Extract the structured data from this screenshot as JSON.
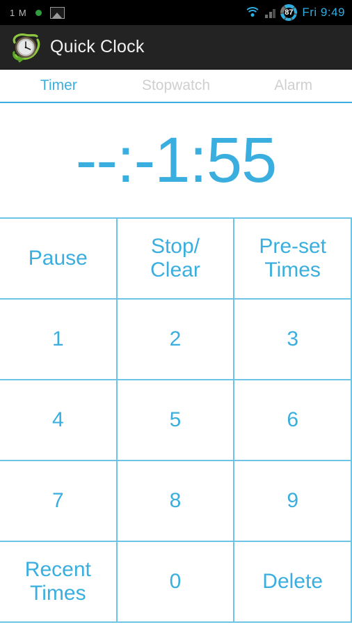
{
  "status_bar": {
    "carrier": "1 M",
    "notification_dot_color": "#2e9e3e",
    "icons": [
      "image-icon",
      "wifi-icon",
      "signal-icon"
    ],
    "battery_percent": "87",
    "clock": "Fri  9:49",
    "accent_color": "#2eaee0",
    "background": "#000000"
  },
  "title_bar": {
    "app_name": "Quick Clock",
    "icon": "alarm-clock-icon",
    "background": "#232323",
    "text_color": "#f2f2f2"
  },
  "tabs": {
    "active_index": 0,
    "items": [
      {
        "label": "Timer",
        "state": "active"
      },
      {
        "label": "Stopwatch",
        "state": "inactive"
      },
      {
        "label": "Alarm",
        "state": "inactive"
      }
    ],
    "active_color": "#3aaede",
    "inactive_color": "#cfcfcf",
    "underline_color": "#3aaede"
  },
  "timer": {
    "display_value": "--:-1:55",
    "color": "#3aaede"
  },
  "keypad": {
    "border_color": "#6ec4e6",
    "text_color": "#3aaede",
    "rows": [
      [
        {
          "name": "pause",
          "lines": [
            "Pause"
          ]
        },
        {
          "name": "stop-clear",
          "lines": [
            "Stop/",
            "Clear"
          ]
        },
        {
          "name": "preset-times",
          "lines": [
            "Pre-set",
            "Times"
          ]
        }
      ],
      [
        {
          "name": "key-1",
          "lines": [
            "1"
          ]
        },
        {
          "name": "key-2",
          "lines": [
            "2"
          ]
        },
        {
          "name": "key-3",
          "lines": [
            "3"
          ]
        }
      ],
      [
        {
          "name": "key-4",
          "lines": [
            "4"
          ]
        },
        {
          "name": "key-5",
          "lines": [
            "5"
          ]
        },
        {
          "name": "key-6",
          "lines": [
            "6"
          ]
        }
      ],
      [
        {
          "name": "key-7",
          "lines": [
            "7"
          ]
        },
        {
          "name": "key-8",
          "lines": [
            "8"
          ]
        },
        {
          "name": "key-9",
          "lines": [
            "9"
          ]
        }
      ],
      [
        {
          "name": "recent-times",
          "lines": [
            "Recent",
            "Times"
          ]
        },
        {
          "name": "key-0",
          "lines": [
            "0"
          ]
        },
        {
          "name": "delete",
          "lines": [
            "Delete"
          ]
        }
      ]
    ]
  }
}
